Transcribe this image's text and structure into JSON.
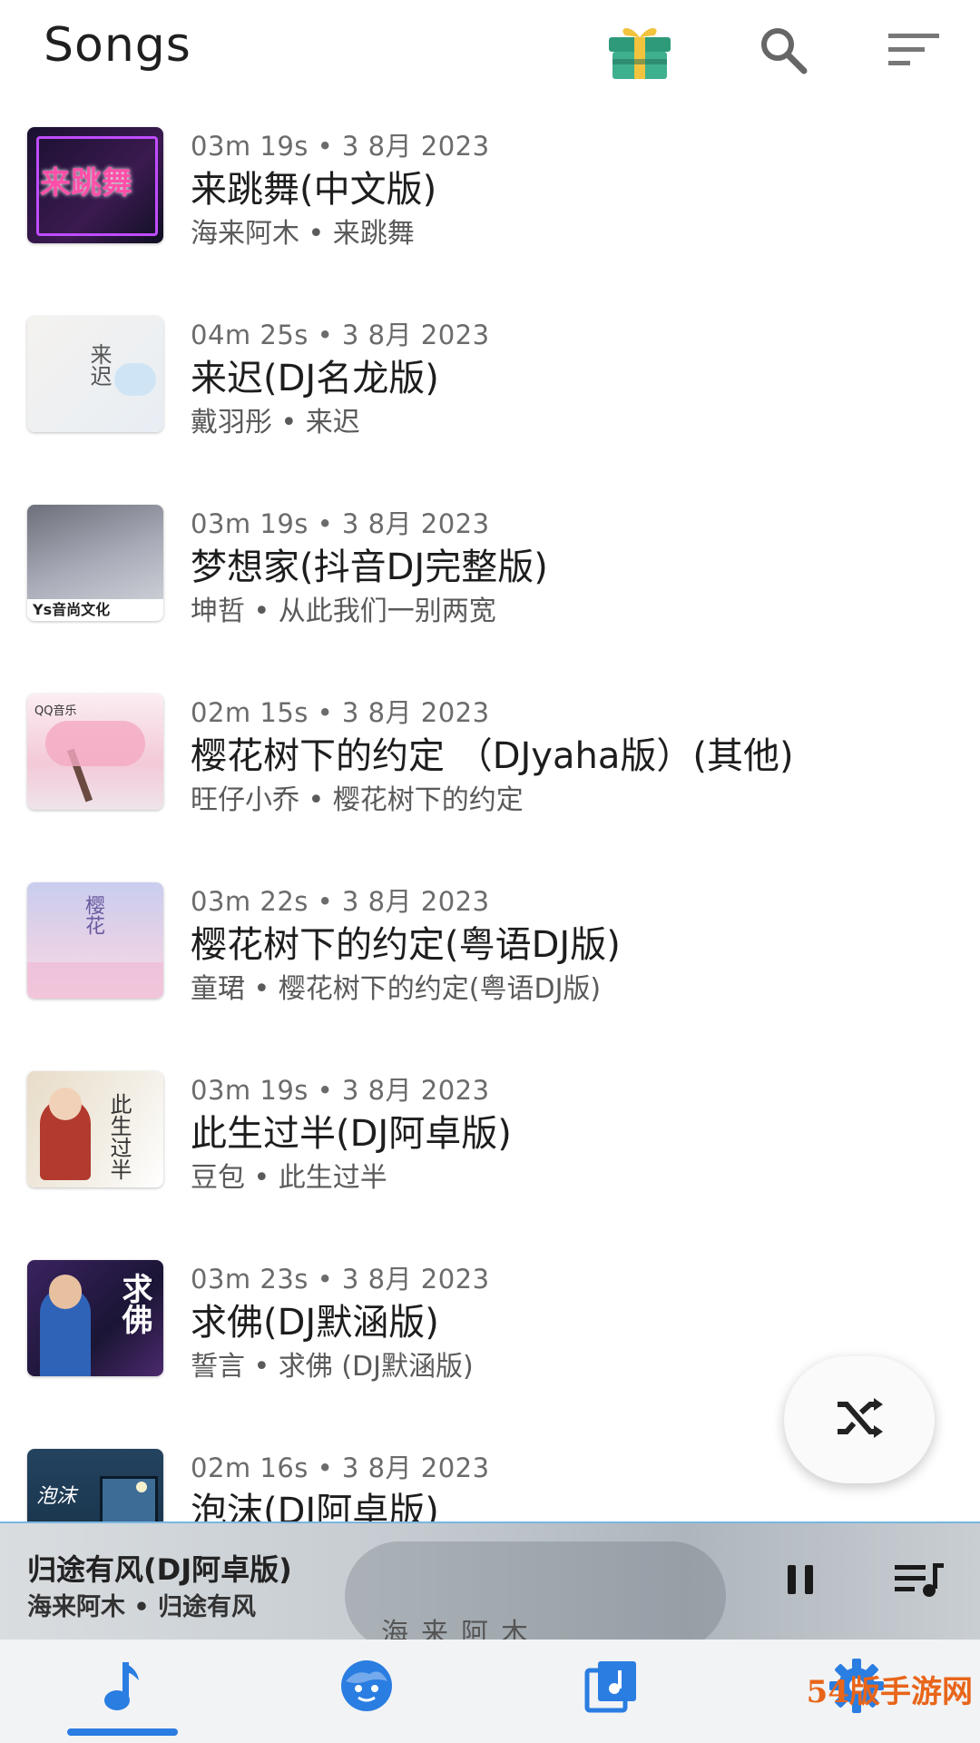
{
  "header": {
    "title": "Songs",
    "icons": [
      "gift-icon",
      "search-icon",
      "sort-icon"
    ]
  },
  "songs": [
    {
      "meta": "03m 19s  •  3 8月 2023",
      "title": "来跳舞(中文版)",
      "artist": "海来阿木  •  来跳舞",
      "art_color": "#1a1030",
      "art_text": "来跳舞"
    },
    {
      "meta": "04m 25s  •  3 8月 2023",
      "title": "来迟(DJ名龙版)",
      "artist": "戴羽彤  •  来迟",
      "art_color": "#f1efec",
      "art_text": "来迟"
    },
    {
      "meta": "03m 19s  •  3 8月 2023",
      "title": "梦想家(抖音DJ完整版)",
      "artist": "坤哲  •  从此我们一别两宽",
      "art_color": "#8d8f9a",
      "art_text": "Ys音尚文化"
    },
    {
      "meta": "02m 15s  •  3 8月 2023",
      "title": "樱花树下的约定 （DJyaha版）(其他)",
      "artist": "旺仔小乔  •  樱花树下的约定",
      "art_color": "#f6dbe4",
      "art_text": "QQ音乐"
    },
    {
      "meta": "03m 22s  •  3 8月 2023",
      "title": "樱花树下的约定(粤语DJ版)",
      "artist": "童珺  •  樱花树下的约定(粤语DJ版)",
      "art_color": "#c9cdee",
      "art_text": "樱花"
    },
    {
      "meta": "03m 19s  •  3 8月 2023",
      "title": "此生过半(DJ阿卓版)",
      "artist": "豆包  •  此生过半",
      "art_color": "#d9c7a8",
      "art_text": "此生过半"
    },
    {
      "meta": "03m 23s  •  3 8月 2023",
      "title": "求佛(DJ默涵版)",
      "artist": "誓言  •  求佛 (DJ默涵版)",
      "art_color": "#2a1f4a",
      "art_text": "求佛"
    },
    {
      "meta": "02m 16s  •  3 8月 2023",
      "title": "泡沫(DJ阿卓版)",
      "artist": "",
      "art_color": "#1e3550",
      "art_text": "泡沫"
    }
  ],
  "player": {
    "title": "归途有风(DJ阿卓版)",
    "artist": "海来阿木  •  归途有风",
    "bg_text": "海来阿木",
    "progress_fraction": 1.0
  },
  "fab": {
    "icon": "shuffle-icon"
  },
  "nav": {
    "tabs": [
      "music-note-icon",
      "face-icon",
      "album-icon",
      "settings-icon"
    ],
    "selected_index": 0,
    "watermark": "54版手游网"
  },
  "colors": {
    "accent": "#2a7de1",
    "progress": "#7ab6e0"
  }
}
